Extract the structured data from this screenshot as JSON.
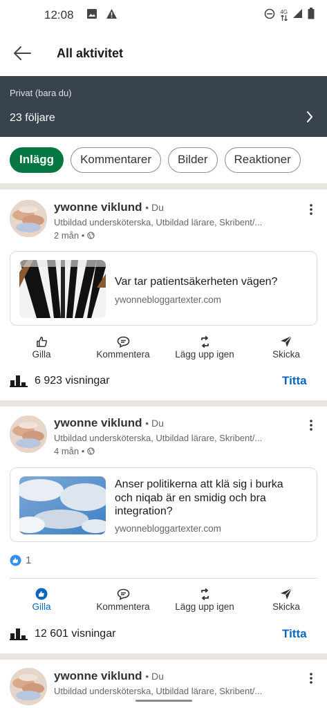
{
  "status_bar": {
    "time": "12:08",
    "network_label": "4G"
  },
  "header": {
    "title": "All aktivitet"
  },
  "privacy_banner": {
    "note": "Privat (bara du)",
    "followers": "23 följare"
  },
  "filters": [
    {
      "label": "Inlägg",
      "active": true
    },
    {
      "label": "Kommentarer",
      "active": false
    },
    {
      "label": "Bilder",
      "active": false
    },
    {
      "label": "Reaktioner",
      "active": false
    }
  ],
  "colors": {
    "brand_green": "#057642",
    "link_blue": "#0a66c2",
    "banner_bg": "#38434f"
  },
  "posts": [
    {
      "author": "ywonne viklund",
      "degree": "• Du",
      "headline": "Utbildad undersköterska, Utbildad lärare, Skribent/...",
      "time": "2 mån •",
      "link_title": "Var tar patientsäkerheten vägen?",
      "link_domain": "ywonnebloggartexter.com",
      "views": "6 923 visningar",
      "watch": "Titta"
    },
    {
      "author": "ywonne viklund",
      "degree": "• Du",
      "headline": "Utbildad undersköterska, Utbildad lärare, Skribent/...",
      "time": "4 mån •",
      "link_title": "Anser politikerna att klä sig i burka och niqab är en smidig och bra integration?",
      "link_domain": "ywonnebloggartexter.com",
      "reaction_count": "1",
      "views": "12 601 visningar",
      "watch": "Titta"
    },
    {
      "author": "ywonne viklund",
      "degree": "• Du",
      "headline": "Utbildad undersköterska, Utbildad lärare, Skribent/..."
    }
  ],
  "actions": {
    "like": "Gilla",
    "comment": "Kommentera",
    "repost": "Lägg upp igen",
    "send": "Skicka"
  }
}
